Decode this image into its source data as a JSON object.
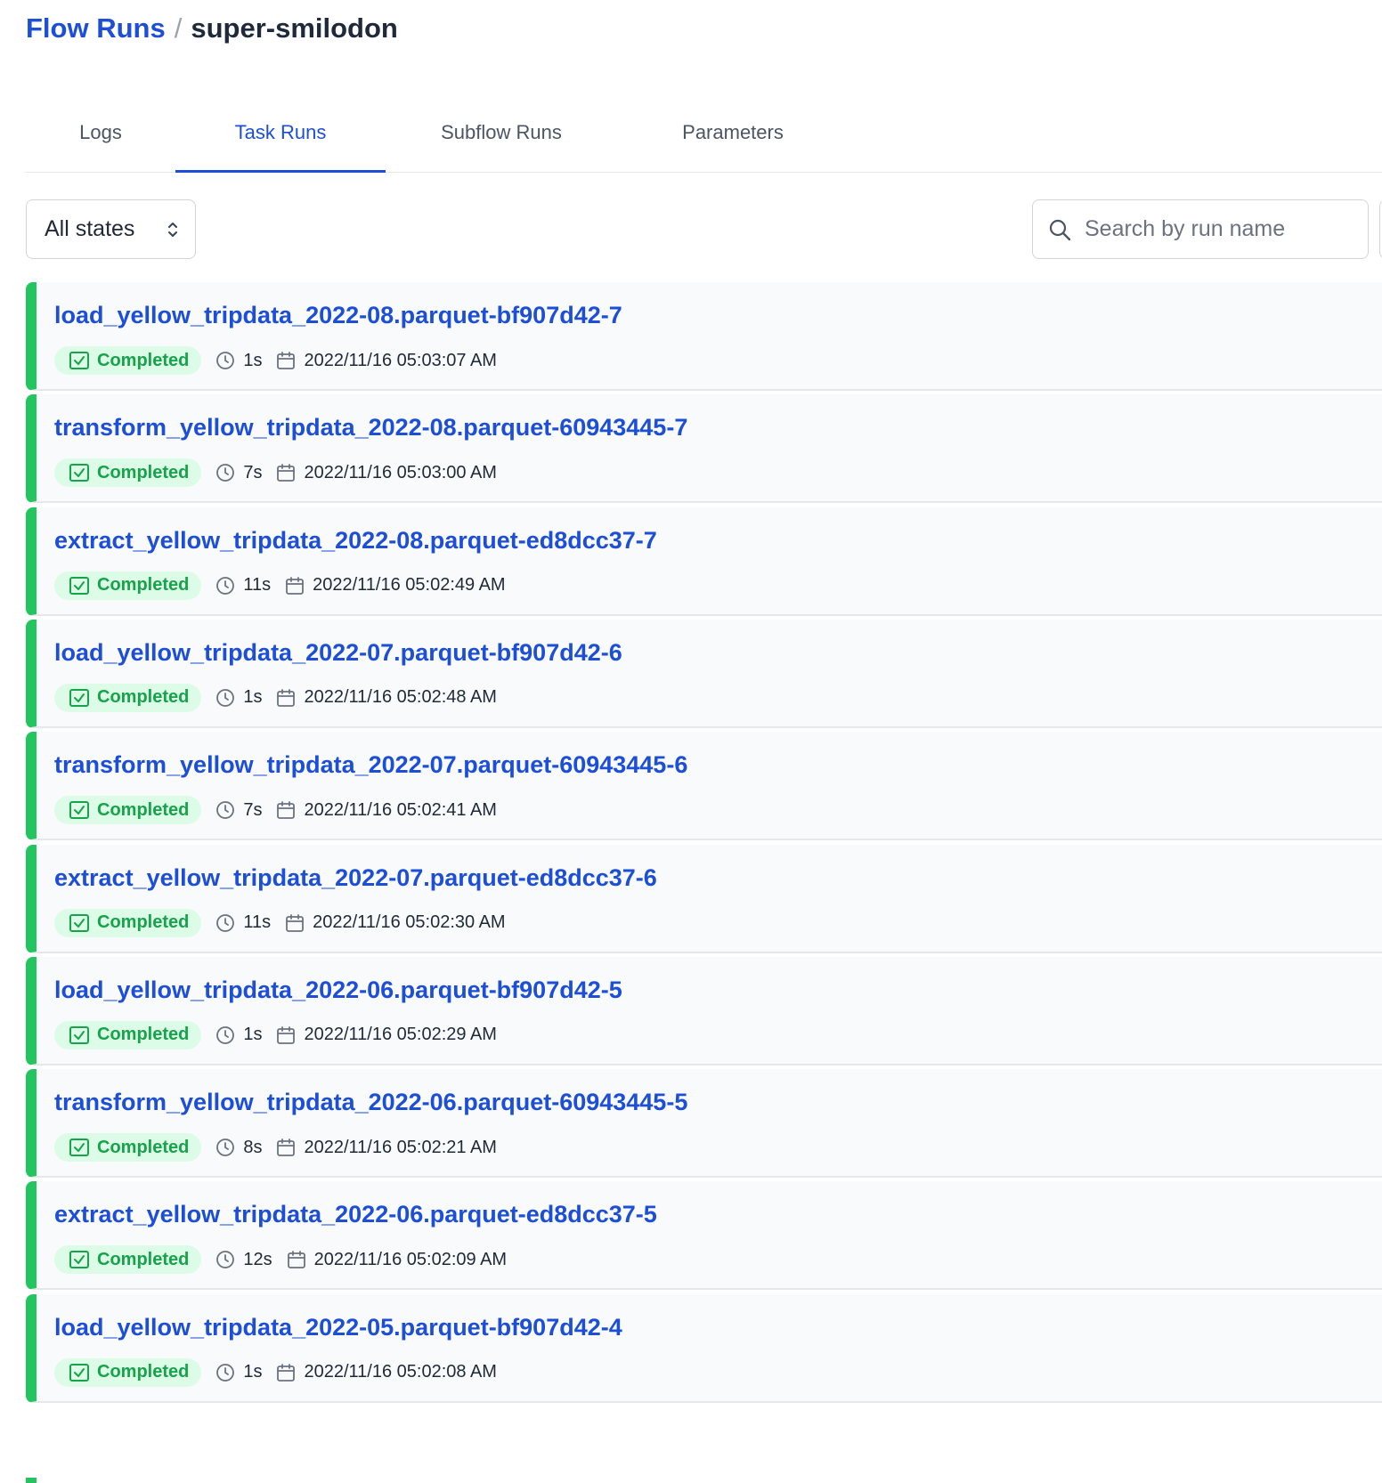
{
  "breadcrumb": {
    "parent": "Flow Runs",
    "separator": "/",
    "current": "super-smilodon"
  },
  "tabs": [
    {
      "label": "Logs",
      "active": false
    },
    {
      "label": "Task Runs",
      "active": true
    },
    {
      "label": "Subflow Runs",
      "active": false
    },
    {
      "label": "Parameters",
      "active": false
    }
  ],
  "filter": {
    "selected": "All states"
  },
  "search": {
    "placeholder": "Search by run name",
    "value": ""
  },
  "colors": {
    "accent": "#1d4ed8",
    "completed": "#22c55e",
    "badge_bg": "#dcfce7",
    "badge_text": "#16a34a"
  },
  "task_runs": [
    {
      "name": "load_yellow_tripdata_2022-08.parquet-bf907d42-7",
      "state": "Completed",
      "duration": "1s",
      "start_time": "2022/11/16 05:03:07 AM"
    },
    {
      "name": "transform_yellow_tripdata_2022-08.parquet-60943445-7",
      "state": "Completed",
      "duration": "7s",
      "start_time": "2022/11/16 05:03:00 AM"
    },
    {
      "name": "extract_yellow_tripdata_2022-08.parquet-ed8dcc37-7",
      "state": "Completed",
      "duration": "11s",
      "start_time": "2022/11/16 05:02:49 AM"
    },
    {
      "name": "load_yellow_tripdata_2022-07.parquet-bf907d42-6",
      "state": "Completed",
      "duration": "1s",
      "start_time": "2022/11/16 05:02:48 AM"
    },
    {
      "name": "transform_yellow_tripdata_2022-07.parquet-60943445-6",
      "state": "Completed",
      "duration": "7s",
      "start_time": "2022/11/16 05:02:41 AM"
    },
    {
      "name": "extract_yellow_tripdata_2022-07.parquet-ed8dcc37-6",
      "state": "Completed",
      "duration": "11s",
      "start_time": "2022/11/16 05:02:30 AM"
    },
    {
      "name": "load_yellow_tripdata_2022-06.parquet-bf907d42-5",
      "state": "Completed",
      "duration": "1s",
      "start_time": "2022/11/16 05:02:29 AM"
    },
    {
      "name": "transform_yellow_tripdata_2022-06.parquet-60943445-5",
      "state": "Completed",
      "duration": "8s",
      "start_time": "2022/11/16 05:02:21 AM"
    },
    {
      "name": "extract_yellow_tripdata_2022-06.parquet-ed8dcc37-5",
      "state": "Completed",
      "duration": "12s",
      "start_time": "2022/11/16 05:02:09 AM"
    },
    {
      "name": "load_yellow_tripdata_2022-05.parquet-bf907d42-4",
      "state": "Completed",
      "duration": "1s",
      "start_time": "2022/11/16 05:02:08 AM"
    }
  ]
}
